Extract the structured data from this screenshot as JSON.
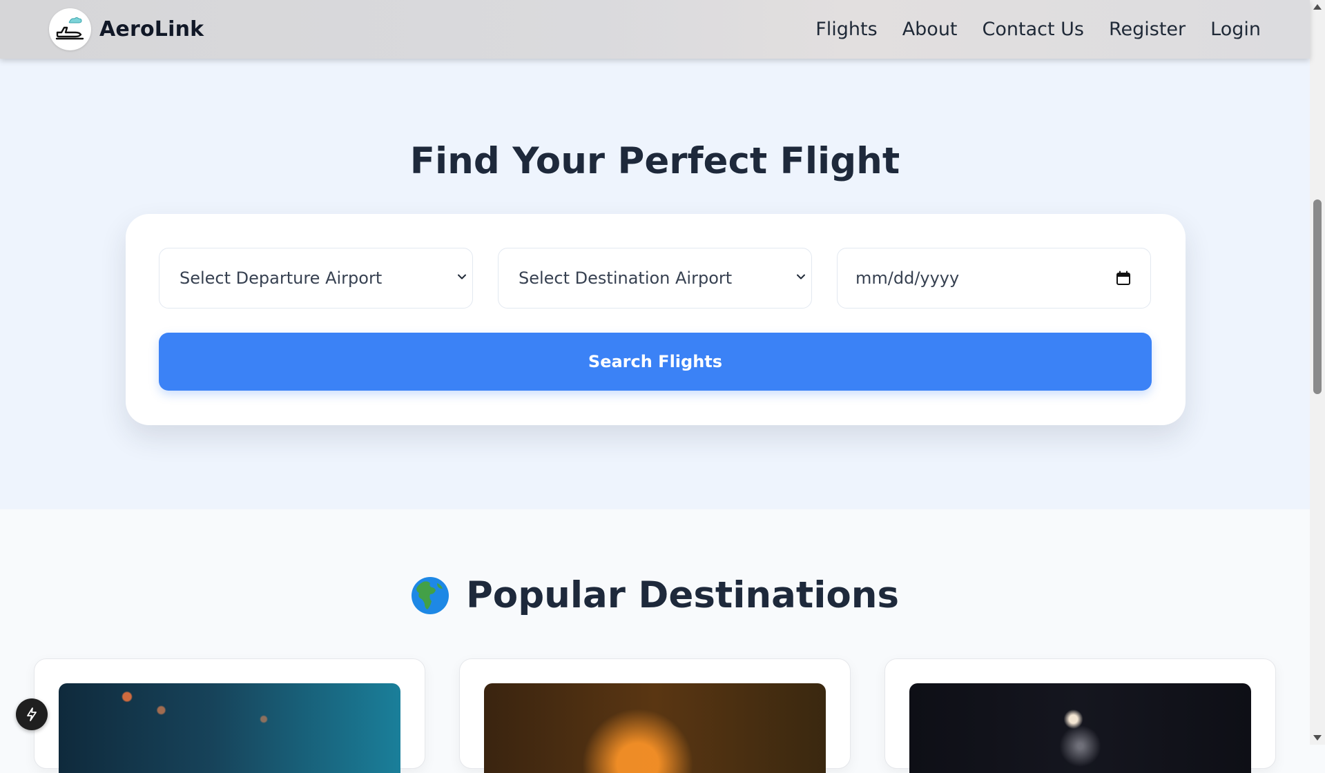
{
  "navbar": {
    "brand": "AeroLink",
    "links": [
      "Flights",
      "About",
      "Contact Us",
      "Register",
      "Login"
    ]
  },
  "hero": {
    "title": "Find Your Perfect Flight",
    "departure_select": "Select Departure Airport",
    "destination_select": "Select Destination Airport",
    "date_placeholder": "mm/dd/yyyy",
    "search_button": "Search Flights"
  },
  "destinations": {
    "title": "Popular Destinations",
    "title_icon": "globe-africa-emoji"
  },
  "colors": {
    "primary": "#3b82f6",
    "heading": "#1e293b",
    "hero_bg": "#eef4fd",
    "page_bg": "#f8fafc"
  },
  "icons": {
    "logo": "airplane-cloud-icon",
    "select_arrow": "chevron-down-icon",
    "date": "calendar-icon",
    "fab": "lightning-icon"
  }
}
